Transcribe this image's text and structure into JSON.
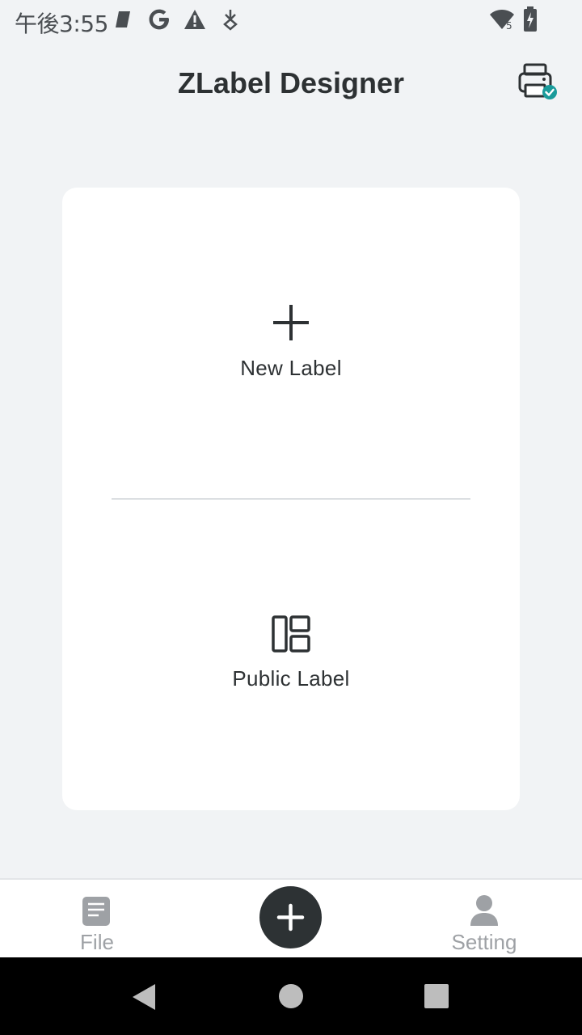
{
  "status_bar": {
    "time": "午後3:55",
    "icons": [
      "notification-icon",
      "google-icon",
      "alert-icon",
      "download-icon",
      "wifi-icon",
      "battery-charging-icon"
    ],
    "wifi_badge": "5"
  },
  "app_bar": {
    "title": "ZLabel Designer",
    "printer_icon": "printer-connected-icon",
    "accent_color": "#1a9b9b"
  },
  "card": {
    "new_label": "New Label",
    "public_label": "Public Label"
  },
  "bottom_nav": {
    "file": "File",
    "setting": "Setting",
    "fab_icon": "plus-icon"
  },
  "system_nav": [
    "back-icon",
    "home-icon",
    "recents-icon"
  ]
}
